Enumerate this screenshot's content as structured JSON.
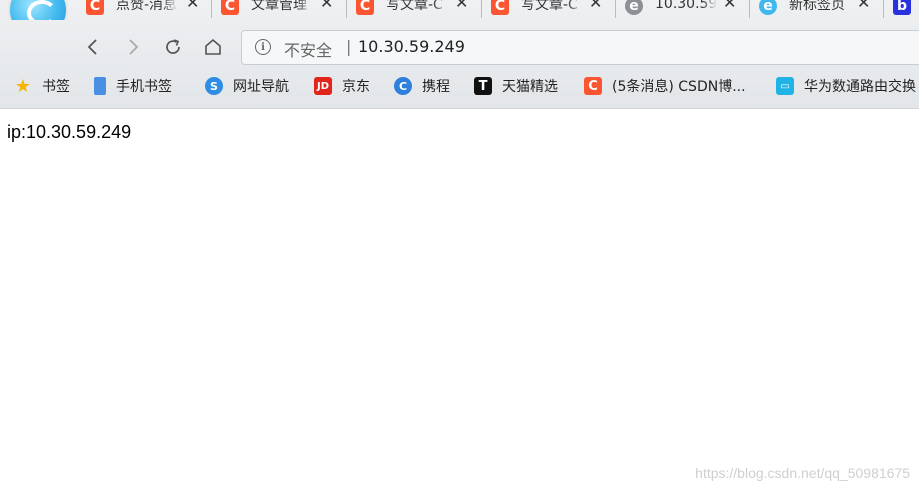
{
  "browser": {
    "tabs": [
      {
        "title": "点赞-消息",
        "icon": "csdn-icon"
      },
      {
        "title": "文章管理",
        "icon": "csdn-icon"
      },
      {
        "title": "写文章-C",
        "icon": "csdn-icon"
      },
      {
        "title": "写文章-C",
        "icon": "csdn-icon"
      },
      {
        "title": "10.30.59",
        "icon": "globe-icon"
      },
      {
        "title": "新标签页",
        "icon": "browser-icon"
      }
    ],
    "omnibox": {
      "security_label": "不安全",
      "divider": "|",
      "url": "10.30.59.249"
    },
    "bookmarks": [
      {
        "label": "书签",
        "icon": "star-icon"
      },
      {
        "label": "手机书签",
        "icon": "phone-icon"
      },
      {
        "label": "网址导航",
        "icon": "nav-icon"
      },
      {
        "label": "京东",
        "icon": "jd-icon"
      },
      {
        "label": "携程",
        "icon": "ctrip-icon"
      },
      {
        "label": "天猫精选",
        "icon": "tmall-icon"
      },
      {
        "label": "(5条消息) CSDN博...",
        "icon": "csdn-icon"
      },
      {
        "label": "华为数通路由交换",
        "icon": "bilibili-icon"
      }
    ],
    "colors": {
      "csdn": "#fc5531",
      "jd": "#e1251b",
      "tmall": "#e4002b",
      "accent": "#3fb8ee"
    }
  },
  "page": {
    "content_text": "ip:10.30.59.249",
    "watermark": "https://blog.csdn.net/qq_50981675"
  }
}
